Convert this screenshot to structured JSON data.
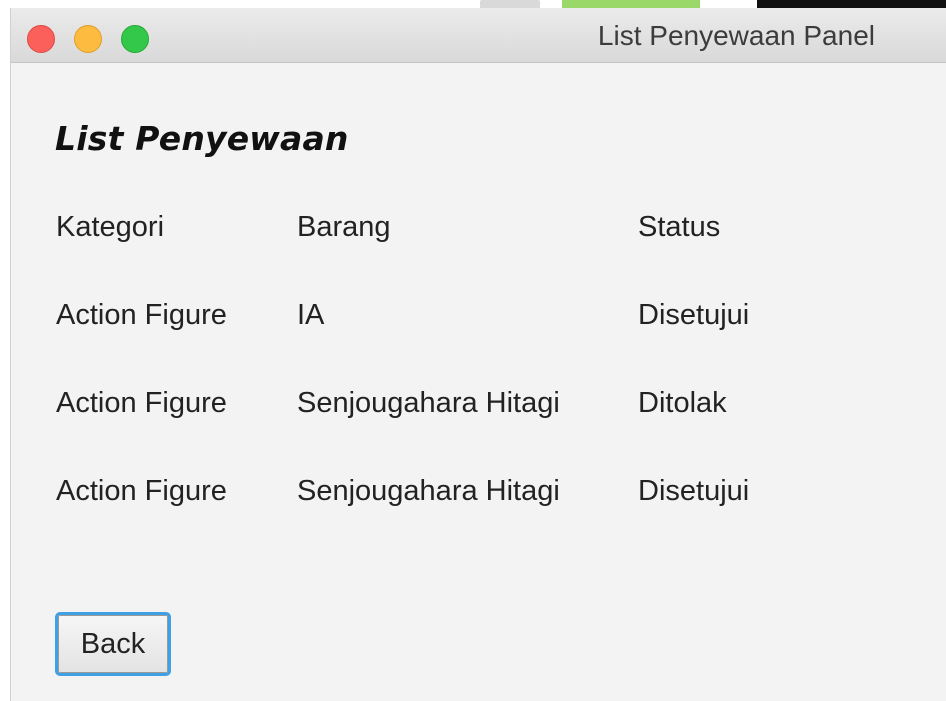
{
  "window": {
    "title": "List Penyewaan Panel",
    "controls": [
      "close",
      "minimize",
      "zoom"
    ],
    "control_colors": {
      "close": "#fc605b",
      "minimize": "#fdbc40",
      "zoom": "#34c84a"
    }
  },
  "panel": {
    "heading": "List Penyewaan"
  },
  "table": {
    "headers": {
      "kategori": "Kategori",
      "barang": "Barang",
      "status": "Status"
    },
    "rows": [
      {
        "kategori": "Action Figure",
        "barang": "IA",
        "status": "Disetujui"
      },
      {
        "kategori": "Action Figure",
        "barang": "Senjougahara Hitagi",
        "status": "Ditolak"
      },
      {
        "kategori": "Action Figure",
        "barang": "Senjougahara Hitagi",
        "status": "Disetujui"
      }
    ]
  },
  "actions": {
    "back_label": "Back",
    "focus_color": "#3fa1e3"
  }
}
